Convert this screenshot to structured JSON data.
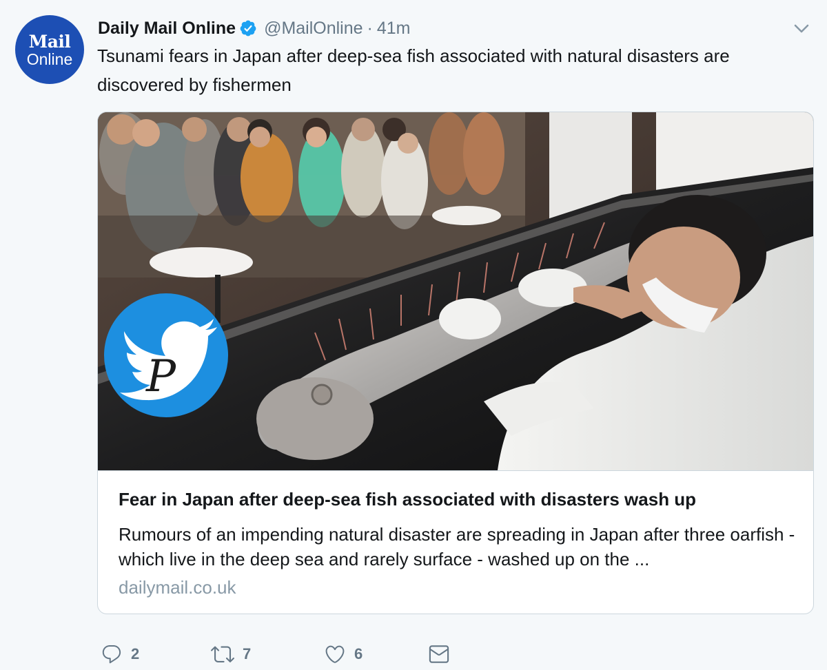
{
  "account": {
    "avatar_line1": "Mail",
    "avatar_line2": "Online",
    "display_name": "Daily Mail Online",
    "handle": "@MailOnline",
    "separator": "·",
    "time": "41m",
    "verified": true
  },
  "tweet": {
    "text": "Tsunami fears in Japan after deep-sea fish associated with natural disasters are discovered by fishermen"
  },
  "card": {
    "image_description_icons": [
      "watermark-bird-p-icon"
    ],
    "title": "Fear in Japan after deep-sea fish associated with disasters wash up",
    "description": "Rumours of an impending natural disaster are spreading in Japan after three oarfish - which live in the deep sea and rarely surface - washed up on the ...",
    "domain": "dailymail.co.uk"
  },
  "actions": {
    "replies": "2",
    "retweets": "7",
    "likes": "6"
  },
  "colors": {
    "background": "#f5f8fa",
    "avatar_blue": "#1d4fb4",
    "verified_blue": "#1da1f2",
    "muted_gray": "#657786",
    "border": "#ccd6dd",
    "watermark_blue": "#1d8fe0"
  }
}
